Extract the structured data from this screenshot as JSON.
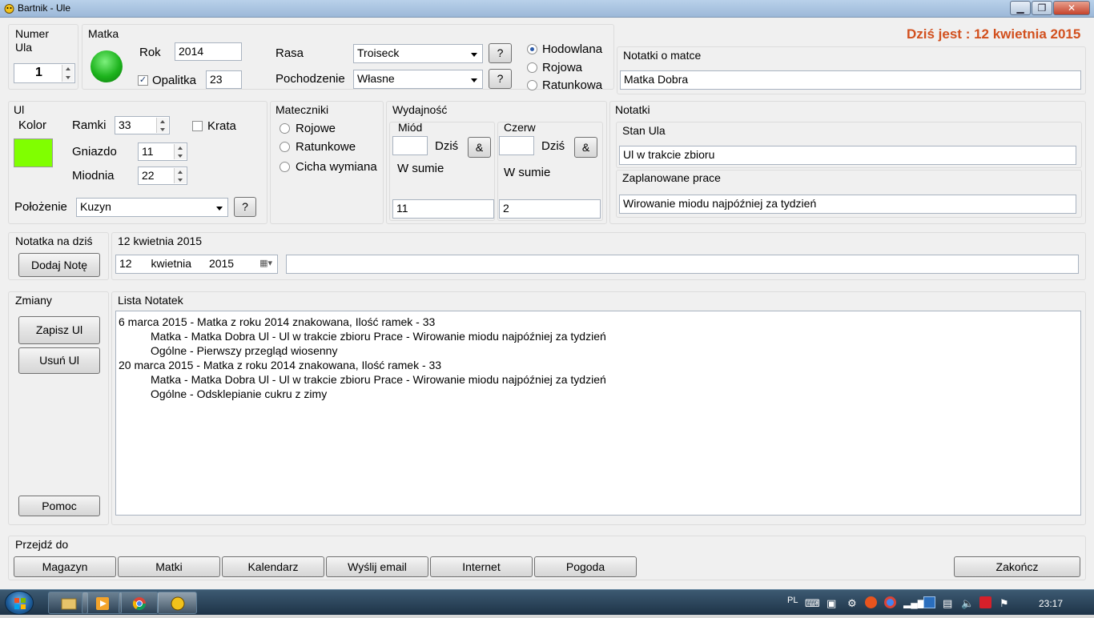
{
  "window": {
    "title": "Bartnik - Ule"
  },
  "today": "Dziś jest : 12 kwietnia 2015",
  "hive_number": {
    "label": "Numer Ula",
    "value": "1"
  },
  "queen": {
    "title": "Matka",
    "status_color": "#1db31d",
    "year_label": "Rok",
    "year_value": "2014",
    "opalitka_label": "Opalitka",
    "opalitka_checked": true,
    "opalitka_value": "23",
    "breed_label": "Rasa",
    "breed_value": "Troiseck",
    "origin_label": "Pochodzenie",
    "origin_value": "Własne",
    "help_label": "?",
    "types": [
      {
        "label": "Hodowlana",
        "selected": true
      },
      {
        "label": "Rojowa",
        "selected": false
      },
      {
        "label": "Ratunkowa",
        "selected": false
      }
    ],
    "notes_title": "Notatki o matce",
    "notes_value": "Matka Dobra"
  },
  "hive": {
    "title": "Ul",
    "color_label": "Kolor",
    "color_value": "#80ff00",
    "frames_label": "Ramki",
    "frames_value": "33",
    "grate_label": "Krata",
    "grate_checked": false,
    "nest_label": "Gniazdo",
    "nest_value": "11",
    "honey_label": "Miodnia",
    "honey_value": "22",
    "location_label": "Położenie",
    "location_value": "Kuzyn",
    "help_label": "?"
  },
  "queen_cells": {
    "title": "Mateczniki",
    "items": [
      {
        "label": "Rojowe",
        "selected": false
      },
      {
        "label": "Ratunkowe",
        "selected": false
      },
      {
        "label": "Cicha wymiana",
        "selected": false
      }
    ]
  },
  "efficiency": {
    "title": "Wydajność",
    "honey": {
      "title": "Miód",
      "today_label": "Dziś",
      "today_value": "",
      "amp": "&",
      "sum_label": "W sumie",
      "sum_value": "11"
    },
    "brood": {
      "title": "Czerw",
      "today_label": "Dziś",
      "today_value": "",
      "amp": "&",
      "sum_label": "W sumie",
      "sum_value": "2"
    }
  },
  "notes": {
    "title": "Notatki",
    "state_label": "Stan Ula",
    "state_value": "Ul w trakcie zbioru",
    "planned_label": "Zaplanowane prace",
    "planned_value": "Wirowanie miodu najpóźniej za tydzień"
  },
  "today_note": {
    "title": "Notatka na dziś",
    "add_button": "Dodaj Notę",
    "date_label": "12 kwietnia 2015",
    "date_day": "12",
    "date_month": "kwietnia",
    "date_year": "2015",
    "note_value": ""
  },
  "changes": {
    "title": "Zmiany",
    "save_button": "Zapisz Ul",
    "delete_button": "Usuń Ul",
    "help_button": "Pomoc"
  },
  "notes_list": {
    "title": "Lista Notatek",
    "lines": [
      "6 marca 2015 - Matka z roku 2014 znakowana, Ilość ramek - 33",
      "Matka - Matka Dobra Ul - Ul w trakcie zbioru Prace - Wirowanie miodu najpóźniej za tydzień",
      "Ogólne - Pierwszy przegląd wiosenny",
      "20 marca 2015 - Matka z roku 2014 znakowana, Ilość ramek - 33",
      "Matka - Matka Dobra Ul - Ul w trakcie zbioru Prace - Wirowanie miodu najpóźniej za tydzień",
      "Ogólne - Odsklepianie cukru z zimy"
    ]
  },
  "goto": {
    "title": "Przejdź do",
    "buttons": [
      "Magazyn",
      "Matki",
      "Kalendarz",
      "Wyślij email",
      "Internet",
      "Pogoda"
    ],
    "exit_button": "Zakończ"
  },
  "taskbar": {
    "language": "PL",
    "clock": "23:17"
  }
}
